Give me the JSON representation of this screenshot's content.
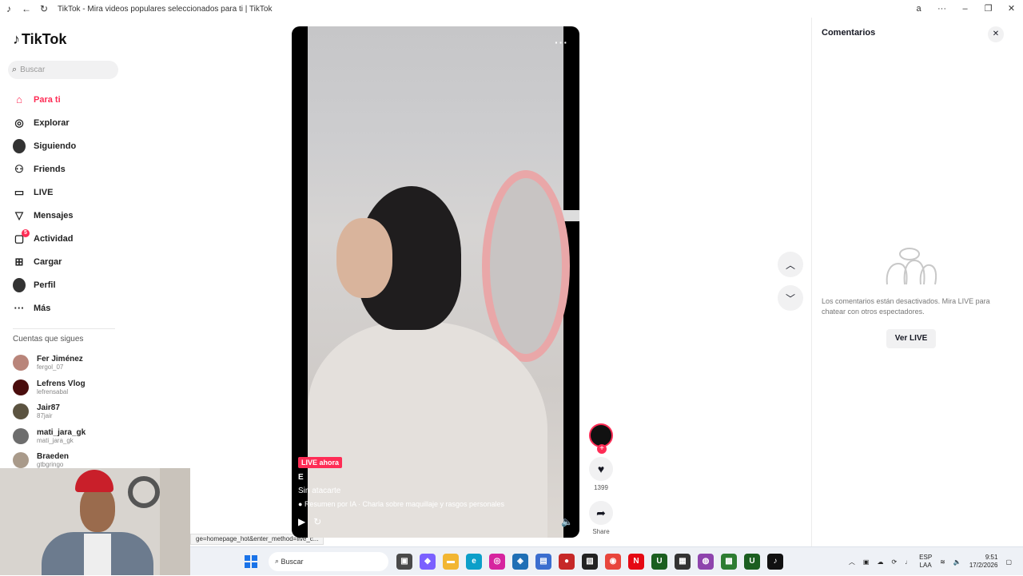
{
  "browser": {
    "title": "TikTok - Mira videos populares seleccionados para ti | TikTok",
    "icons": [
      "tiktok-favicon",
      "back-icon",
      "reload-icon",
      "translate-icon",
      "more-icon",
      "minimize-icon",
      "restore-icon",
      "close-icon"
    ]
  },
  "sidebar": {
    "logo": "TikTok",
    "search_placeholder": "Buscar",
    "nav": [
      {
        "label": "Para ti",
        "icon": "home-icon",
        "glyph": "⌂",
        "active": true
      },
      {
        "label": "Explorar",
        "icon": "compass-icon",
        "glyph": "◎"
      },
      {
        "label": "Siguiendo",
        "icon": "following-avatar-icon",
        "glyph": ""
      },
      {
        "label": "Friends",
        "icon": "friends-icon",
        "glyph": "⚇"
      },
      {
        "label": "LIVE",
        "icon": "live-tv-icon",
        "glyph": "▭"
      },
      {
        "label": "Mensajes",
        "icon": "messages-icon",
        "glyph": "▽"
      },
      {
        "label": "Actividad",
        "icon": "activity-icon",
        "glyph": "▢",
        "badge": "5"
      },
      {
        "label": "Cargar",
        "icon": "upload-icon",
        "glyph": "⊞"
      },
      {
        "label": "Perfil",
        "icon": "profile-avatar-icon",
        "glyph": ""
      },
      {
        "label": "Más",
        "icon": "more-dots-icon",
        "glyph": "···"
      }
    ],
    "following_heading": "Cuentas que sigues",
    "following": [
      {
        "name": "Fer Jiménez",
        "handle": "fergol_07"
      },
      {
        "name": "Lefrens Vlog",
        "handle": "lefrensabal"
      },
      {
        "name": "Jair87",
        "handle": "87jair"
      },
      {
        "name": "mati_jara_gk",
        "handle": "mati_jara_gk"
      },
      {
        "name": "Braeden",
        "handle": "gtbgringo"
      }
    ]
  },
  "status_url": "ge=homepage_hot&enter_method=live_c...",
  "video": {
    "live_badge": "LIVE ahora",
    "author": "E",
    "title": "Sin atacarte",
    "summary": "Resumen por IA · Charla sobre maquillaje y rasgos personales",
    "more": "···"
  },
  "actions": {
    "live_avatar_label": "LIVE",
    "likes": "1399",
    "share_label": "Share"
  },
  "comments": {
    "title": "Comentarios",
    "message": "Los comentarios están desactivados. Mira LIVE para chatear con otros espectadores.",
    "button": "Ver LIVE"
  },
  "taskbar": {
    "search_placeholder": "Buscar",
    "language_top": "ESP",
    "language_bottom": "LAA",
    "time": "9:51",
    "date": "17/2/2026",
    "apps": [
      {
        "name": "file-explorer-icon",
        "color": "#4a4a4a",
        "glyph": "▣"
      },
      {
        "name": "copilot-icon",
        "color": "#7b61ff",
        "glyph": "◆"
      },
      {
        "name": "folder-icon",
        "color": "#f2b632",
        "glyph": "▬"
      },
      {
        "name": "edge-icon",
        "color": "#0c9fc9",
        "glyph": "e"
      },
      {
        "name": "instagram-icon",
        "color": "#d6249f",
        "glyph": "◎"
      },
      {
        "name": "security-icon",
        "color": "#1f6fb5",
        "glyph": "◈"
      },
      {
        "name": "store-icon",
        "color": "#3b6ecf",
        "glyph": "▤"
      },
      {
        "name": "recorder-icon",
        "color": "#c62828",
        "glyph": "●"
      },
      {
        "name": "capcut-icon",
        "color": "#222222",
        "glyph": "▧"
      },
      {
        "name": "chrome-icon",
        "color": "#e8453c",
        "glyph": "◉"
      },
      {
        "name": "netflix-icon",
        "color": "#e50914",
        "glyph": "N"
      },
      {
        "name": "u-app-icon",
        "color": "#1b5e20",
        "glyph": "U"
      },
      {
        "name": "notes-icon",
        "color": "#333333",
        "glyph": "▦"
      },
      {
        "name": "browser-icon",
        "color": "#8e44ad",
        "glyph": "◍"
      },
      {
        "name": "chat-app-icon",
        "color": "#2e7d32",
        "glyph": "▩"
      },
      {
        "name": "u-app-2-icon",
        "color": "#1b5e20",
        "glyph": "U"
      },
      {
        "name": "tiktok-taskbar-icon",
        "color": "#111111",
        "glyph": "♪"
      }
    ]
  }
}
